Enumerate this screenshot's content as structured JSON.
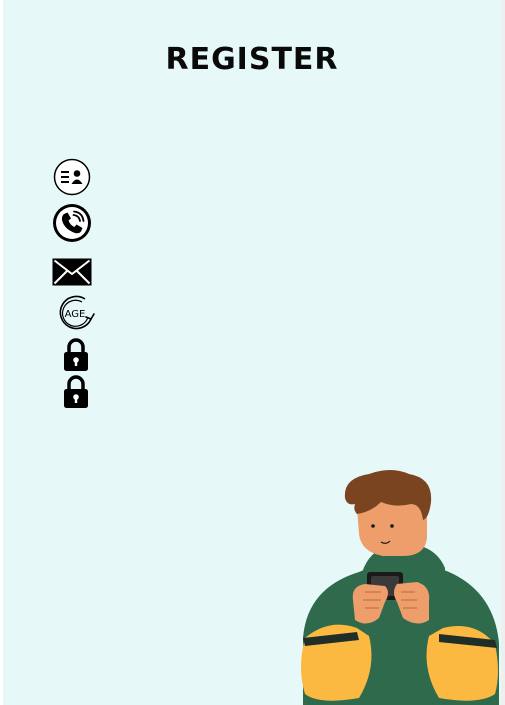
{
  "form": {
    "title": "REGISTER",
    "fields": [
      {
        "icon": "id-card-icon"
      },
      {
        "icon": "phone-icon"
      },
      {
        "icon": "mail-icon"
      },
      {
        "icon": "age-icon",
        "icon_text": "AGE"
      },
      {
        "icon": "lock-icon"
      },
      {
        "icon": "lock-icon"
      }
    ]
  },
  "colors": {
    "panel_background": "#e6f8f8",
    "hoodie": "#2f6a4d",
    "sleeve": "#fbb942",
    "hair": "#7a4420",
    "skin": "#ee9e6a"
  }
}
